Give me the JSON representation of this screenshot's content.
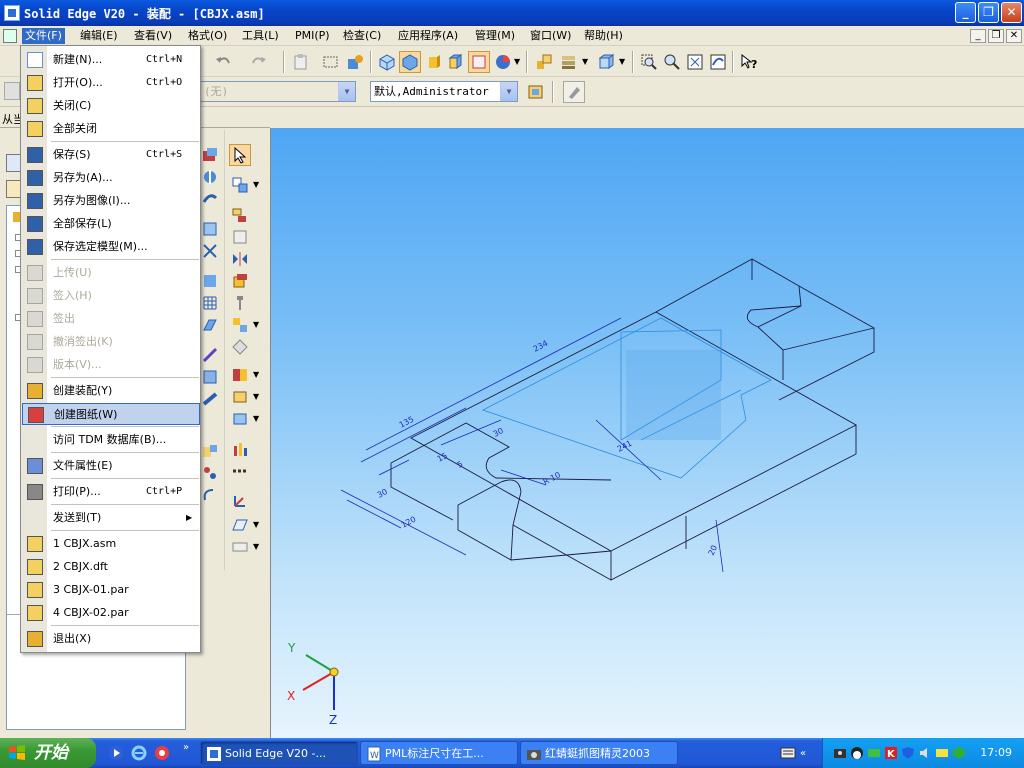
{
  "window": {
    "title": "Solid Edge V20 - 装配 - [CBJX.asm]"
  },
  "menubar": {
    "items": [
      "文件(F)",
      "编辑(E)",
      "查看(V)",
      "格式(O)",
      "工具(L)",
      "PMI(P)",
      "检查(C)",
      "应用程序(A)",
      "管理(M)",
      "窗口(W)",
      "帮助(H)"
    ]
  },
  "toolbar2": {
    "combo_none": "(无)",
    "combo_user": "默认,Administrator"
  },
  "left_strip": {
    "label": "从当"
  },
  "file_menu": {
    "items": [
      {
        "label": "新建(N)...",
        "shortcut": "Ctrl+N",
        "icon": "new-file-icon"
      },
      {
        "label": "打开(O)...",
        "shortcut": "Ctrl+O",
        "icon": "open-folder-icon"
      },
      {
        "label": "关闭(C)",
        "shortcut": "",
        "icon": "close-folder-icon"
      },
      {
        "label": "全部关闭",
        "shortcut": "",
        "icon": "close-all-icon"
      },
      {
        "label": "保存(S)",
        "shortcut": "Ctrl+S",
        "icon": "save-icon"
      },
      {
        "label": "另存为(A)...",
        "shortcut": "",
        "icon": "save-as-icon"
      },
      {
        "label": "另存为图像(I)...",
        "shortcut": "",
        "icon": "save-as-image-icon"
      },
      {
        "label": "全部保存(L)",
        "shortcut": "",
        "icon": "save-all-icon"
      },
      {
        "label": "保存选定模型(M)...",
        "shortcut": "",
        "icon": "save-selected-icon"
      },
      {
        "label": "上传(U)",
        "shortcut": "",
        "icon": "upload-icon"
      },
      {
        "label": "签入(H)",
        "shortcut": "",
        "icon": "check-in-icon"
      },
      {
        "label": "签出",
        "shortcut": "",
        "icon": "check-out-icon"
      },
      {
        "label": "撤消签出(K)",
        "shortcut": "",
        "icon": "undo-checkout-icon"
      },
      {
        "label": "版本(V)...",
        "shortcut": "",
        "icon": "version-icon"
      },
      {
        "label": "创建装配(Y)",
        "shortcut": "",
        "icon": "create-assembly-icon"
      },
      {
        "label": "创建图纸(W)",
        "shortcut": "",
        "icon": "create-drawing-icon"
      },
      {
        "label": "访问 TDM 数据库(B)...",
        "shortcut": "",
        "icon": ""
      },
      {
        "label": "文件属性(E)",
        "shortcut": "",
        "icon": "file-properties-icon"
      },
      {
        "label": "打印(P)...",
        "shortcut": "Ctrl+P",
        "icon": "print-icon"
      },
      {
        "label": "发送到(T)",
        "shortcut": "",
        "icon": ""
      },
      {
        "label": "1 CBJX.asm",
        "shortcut": "",
        "icon": "recent-file-icon"
      },
      {
        "label": "2 CBJX.dft",
        "shortcut": "",
        "icon": "recent-file-icon"
      },
      {
        "label": "3 CBJX-01.par",
        "shortcut": "",
        "icon": "recent-file-icon"
      },
      {
        "label": "4 CBJX-02.par",
        "shortcut": "",
        "icon": "recent-file-icon"
      },
      {
        "label": "退出(X)",
        "shortcut": "",
        "icon": "exit-icon"
      }
    ]
  },
  "viewport": {
    "dimensions": [
      "234",
      "135",
      "5",
      "30",
      "15",
      "R 10",
      "30",
      "241",
      "120",
      "20"
    ],
    "axes": {
      "x": "X",
      "y": "Y",
      "z": "Z"
    }
  },
  "taskbar": {
    "start_label": "开始",
    "tasks": [
      "Solid Edge V20 -...",
      "PML标注尺寸在工...",
      "红蜻蜓抓图精灵2003"
    ],
    "clock": "17:09"
  }
}
